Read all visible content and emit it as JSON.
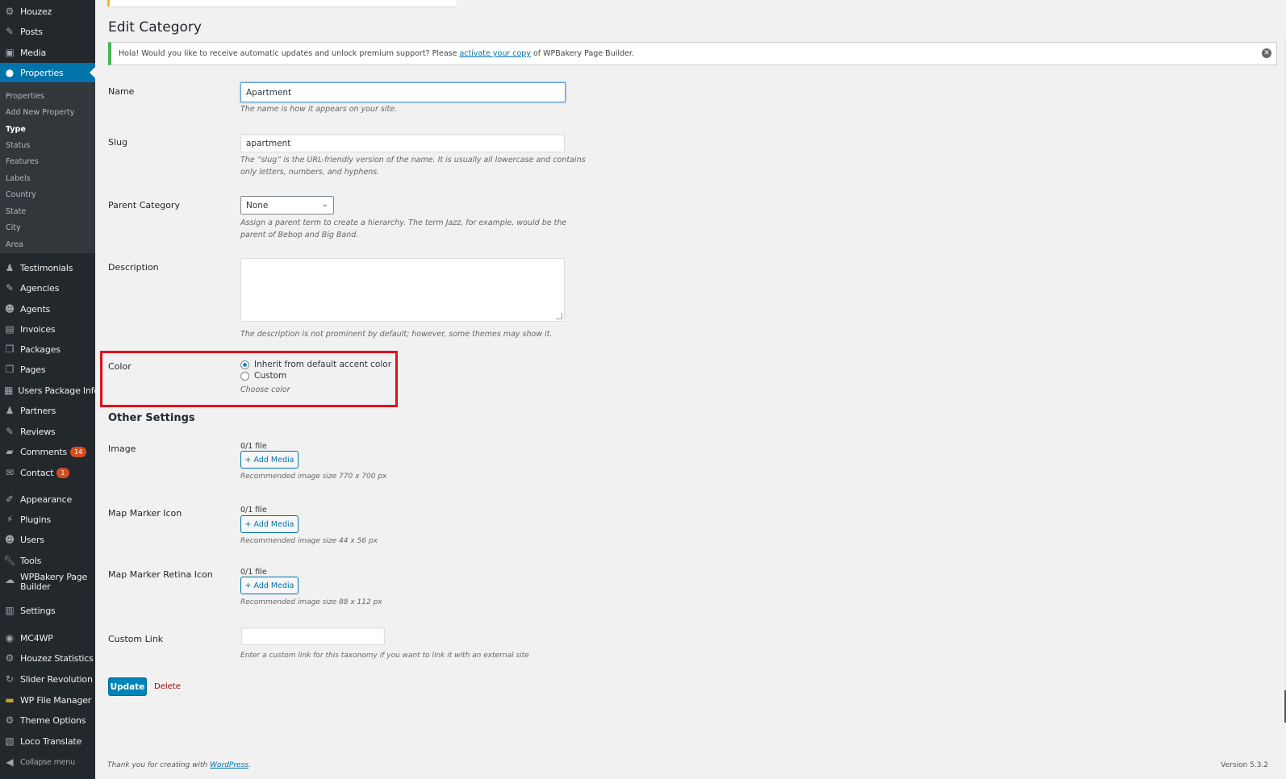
{
  "sidebar": {
    "items": [
      {
        "label": "Houzez",
        "icon": "gear-icon"
      },
      {
        "label": "Posts",
        "icon": "pin-icon"
      },
      {
        "label": "Media",
        "icon": "media-icon"
      },
      {
        "label": "Properties",
        "icon": "location-icon"
      },
      {
        "label": "Testimonials",
        "icon": "person-icon"
      },
      {
        "label": "Agencies",
        "icon": "pin-icon"
      },
      {
        "label": "Agents",
        "icon": "user-icon"
      },
      {
        "label": "Invoices",
        "icon": "book-icon"
      },
      {
        "label": "Packages",
        "icon": "pages-icon"
      },
      {
        "label": "Pages",
        "icon": "pages-icon"
      },
      {
        "label": "Users Package Info",
        "icon": "id-card-icon"
      },
      {
        "label": "Partners",
        "icon": "person-icon"
      },
      {
        "label": "Reviews",
        "icon": "pin-icon"
      },
      {
        "label": "Comments",
        "icon": "comment-icon",
        "badge": "14"
      },
      {
        "label": "Contact",
        "icon": "mail-icon",
        "badge": "1"
      },
      {
        "label": "Appearance",
        "icon": "brush-icon"
      },
      {
        "label": "Plugins",
        "icon": "plug-icon"
      },
      {
        "label": "Users",
        "icon": "user-icon"
      },
      {
        "label": "Tools",
        "icon": "wrench-icon"
      },
      {
        "label": "WPBakery Page Builder",
        "icon": "cloud-icon"
      },
      {
        "label": "Settings",
        "icon": "settings-icon"
      },
      {
        "label": "MC4WP",
        "icon": "mc4wp-icon"
      },
      {
        "label": "Houzez Statistics",
        "icon": "gear-icon"
      },
      {
        "label": "Slider Revolution",
        "icon": "refresh-icon"
      },
      {
        "label": "WP File Manager",
        "icon": "folder-icon"
      },
      {
        "label": "Theme Options",
        "icon": "gear-icon"
      },
      {
        "label": "Loco Translate",
        "icon": "translate-icon"
      },
      {
        "label": "Collapse menu",
        "icon": "collapse-icon"
      }
    ],
    "submenu": [
      "Properties",
      "Add New Property",
      "Type",
      "Status",
      "Features",
      "Labels",
      "Country",
      "State",
      "City",
      "Area"
    ]
  },
  "page": {
    "title": "Edit Category",
    "notice": {
      "prefix": "Hola! Would you like to receive automatic updates and unlock premium support? Please",
      "link": "activate your copy",
      "suffix": "of WPBakery Page Builder."
    }
  },
  "form": {
    "name": {
      "label": "Name",
      "value": "Apartment",
      "desc": "The name is how it appears on your site."
    },
    "slug": {
      "label": "Slug",
      "value": "apartment",
      "desc1": "The “slug” is the URL-friendly version of the name. It is usually all lowercase and contains",
      "desc2": "only letters, numbers, and hyphens."
    },
    "parent": {
      "label": "Parent Category",
      "value": "None",
      "desc1": "Assign a parent term to create a hierarchy. The term Jazz, for example, would be the",
      "desc2": "parent of Bebop and Big Band."
    },
    "description": {
      "label": "Description",
      "desc": "The description is not prominent by default; however, some themes may show it."
    },
    "color": {
      "label": "Color",
      "option1": "Inherit from default accent color",
      "option2": "Custom",
      "desc": "Choose color"
    }
  },
  "other_settings": {
    "heading": "Other Settings",
    "image": {
      "label": "Image",
      "count": "0/1 file",
      "button": "+ Add Media",
      "rec": "Recommended image size 770 x 700 px"
    },
    "marker": {
      "label": "Map Marker Icon",
      "count": "0/1 file",
      "button": "+ Add Media",
      "rec": "Recommended image size 44 x 56 px"
    },
    "marker_retina": {
      "label": "Map Marker Retina Icon",
      "count": "0/1 file",
      "button": "+ Add Media",
      "rec": "Recommended image size 88 x 112 px"
    },
    "custom_link": {
      "label": "Custom Link",
      "value": "",
      "desc": "Enter a custom link for this taxonomy if you want to link it with an external site"
    }
  },
  "actions": {
    "update": "Update",
    "delete": "Delete"
  },
  "footer": {
    "thanks": "Thank you for creating with",
    "wp_link": "WordPress",
    "version": "Version 5.3.2"
  },
  "colors": {
    "sidebar_bg": "#23282d",
    "active": "#0073aa",
    "highlight_border": "#e0101a",
    "notice_border": "#46b450"
  }
}
